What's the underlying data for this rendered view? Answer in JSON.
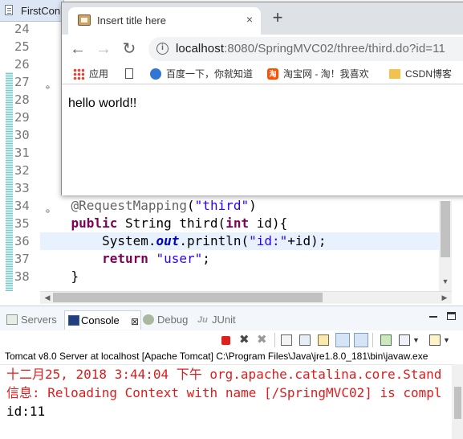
{
  "editor": {
    "tab_title": "FirstCon",
    "line_numbers": [
      "24",
      "25",
      "26",
      "27",
      "28",
      "29",
      "30",
      "31",
      "32",
      "33",
      "34",
      "35",
      "36",
      "37",
      "38",
      ""
    ],
    "code": {
      "l34_anno": "@RequestMapping",
      "l34_open": "(",
      "l34_str": "\"third\"",
      "l34_close": ")",
      "l35_kw1": "public",
      "l35_mid": " String third(",
      "l35_kw2": "int",
      "l35_end": " id){",
      "l36_a": "System.",
      "l36_field": "out",
      "l36_b": ".println(",
      "l36_str": "\"id:\"",
      "l36_c": "+id);",
      "l37_kw": "return",
      "l37_str": "\"user\"",
      "l37_end": ";",
      "l38": "}"
    }
  },
  "browser": {
    "tab_title": "Insert title here",
    "tab_close": "×",
    "new_tab": "+",
    "url_host": "localhost",
    "url_rest": ":8080/SpringMVC02/three/third.do?id=11",
    "bookmarks": [
      {
        "label": "应用",
        "icon": "apps-icon"
      },
      {
        "label": "",
        "icon": "document-icon"
      },
      {
        "label": "百度一下，你就知道",
        "icon": "baidu-icon"
      },
      {
        "label": "淘宝网 - 淘！我喜欢",
        "icon": "taobao-icon",
        "icon_text": "淘"
      },
      {
        "label": "CSDN博客",
        "icon": "folder-icon"
      }
    ],
    "page_text": "hello world!!"
  },
  "console_view": {
    "tabs": [
      {
        "label": "Servers",
        "icon": "servers-icon"
      },
      {
        "label": "Console",
        "icon": "console-icon",
        "close": "⊠"
      },
      {
        "label": "Debug",
        "icon": "debug-icon"
      },
      {
        "label": "JUnit",
        "icon": "junit-icon",
        "icon_text": "Ju"
      }
    ],
    "header": "Tomcat v8.0 Server at localhost [Apache Tomcat] C:\\Program Files\\Java\\jre1.8.0_181\\bin\\javaw.exe",
    "lines": [
      {
        "text": "十二月25, 2018 3:44:04 下午 org.apache.catalina.core.Stand",
        "kind": "err"
      },
      {
        "text": "信息: Reloading Context with name [/SpringMVC02] is compl",
        "kind": "err"
      },
      {
        "text": "id:11",
        "kind": "out"
      }
    ]
  },
  "colors": {
    "keyword": "#7f0055",
    "string": "#2a00ff",
    "annotation": "#646464",
    "field": "#0000c0",
    "console_error": "#e01b1b",
    "highlight_line": "#e8f2fe"
  }
}
